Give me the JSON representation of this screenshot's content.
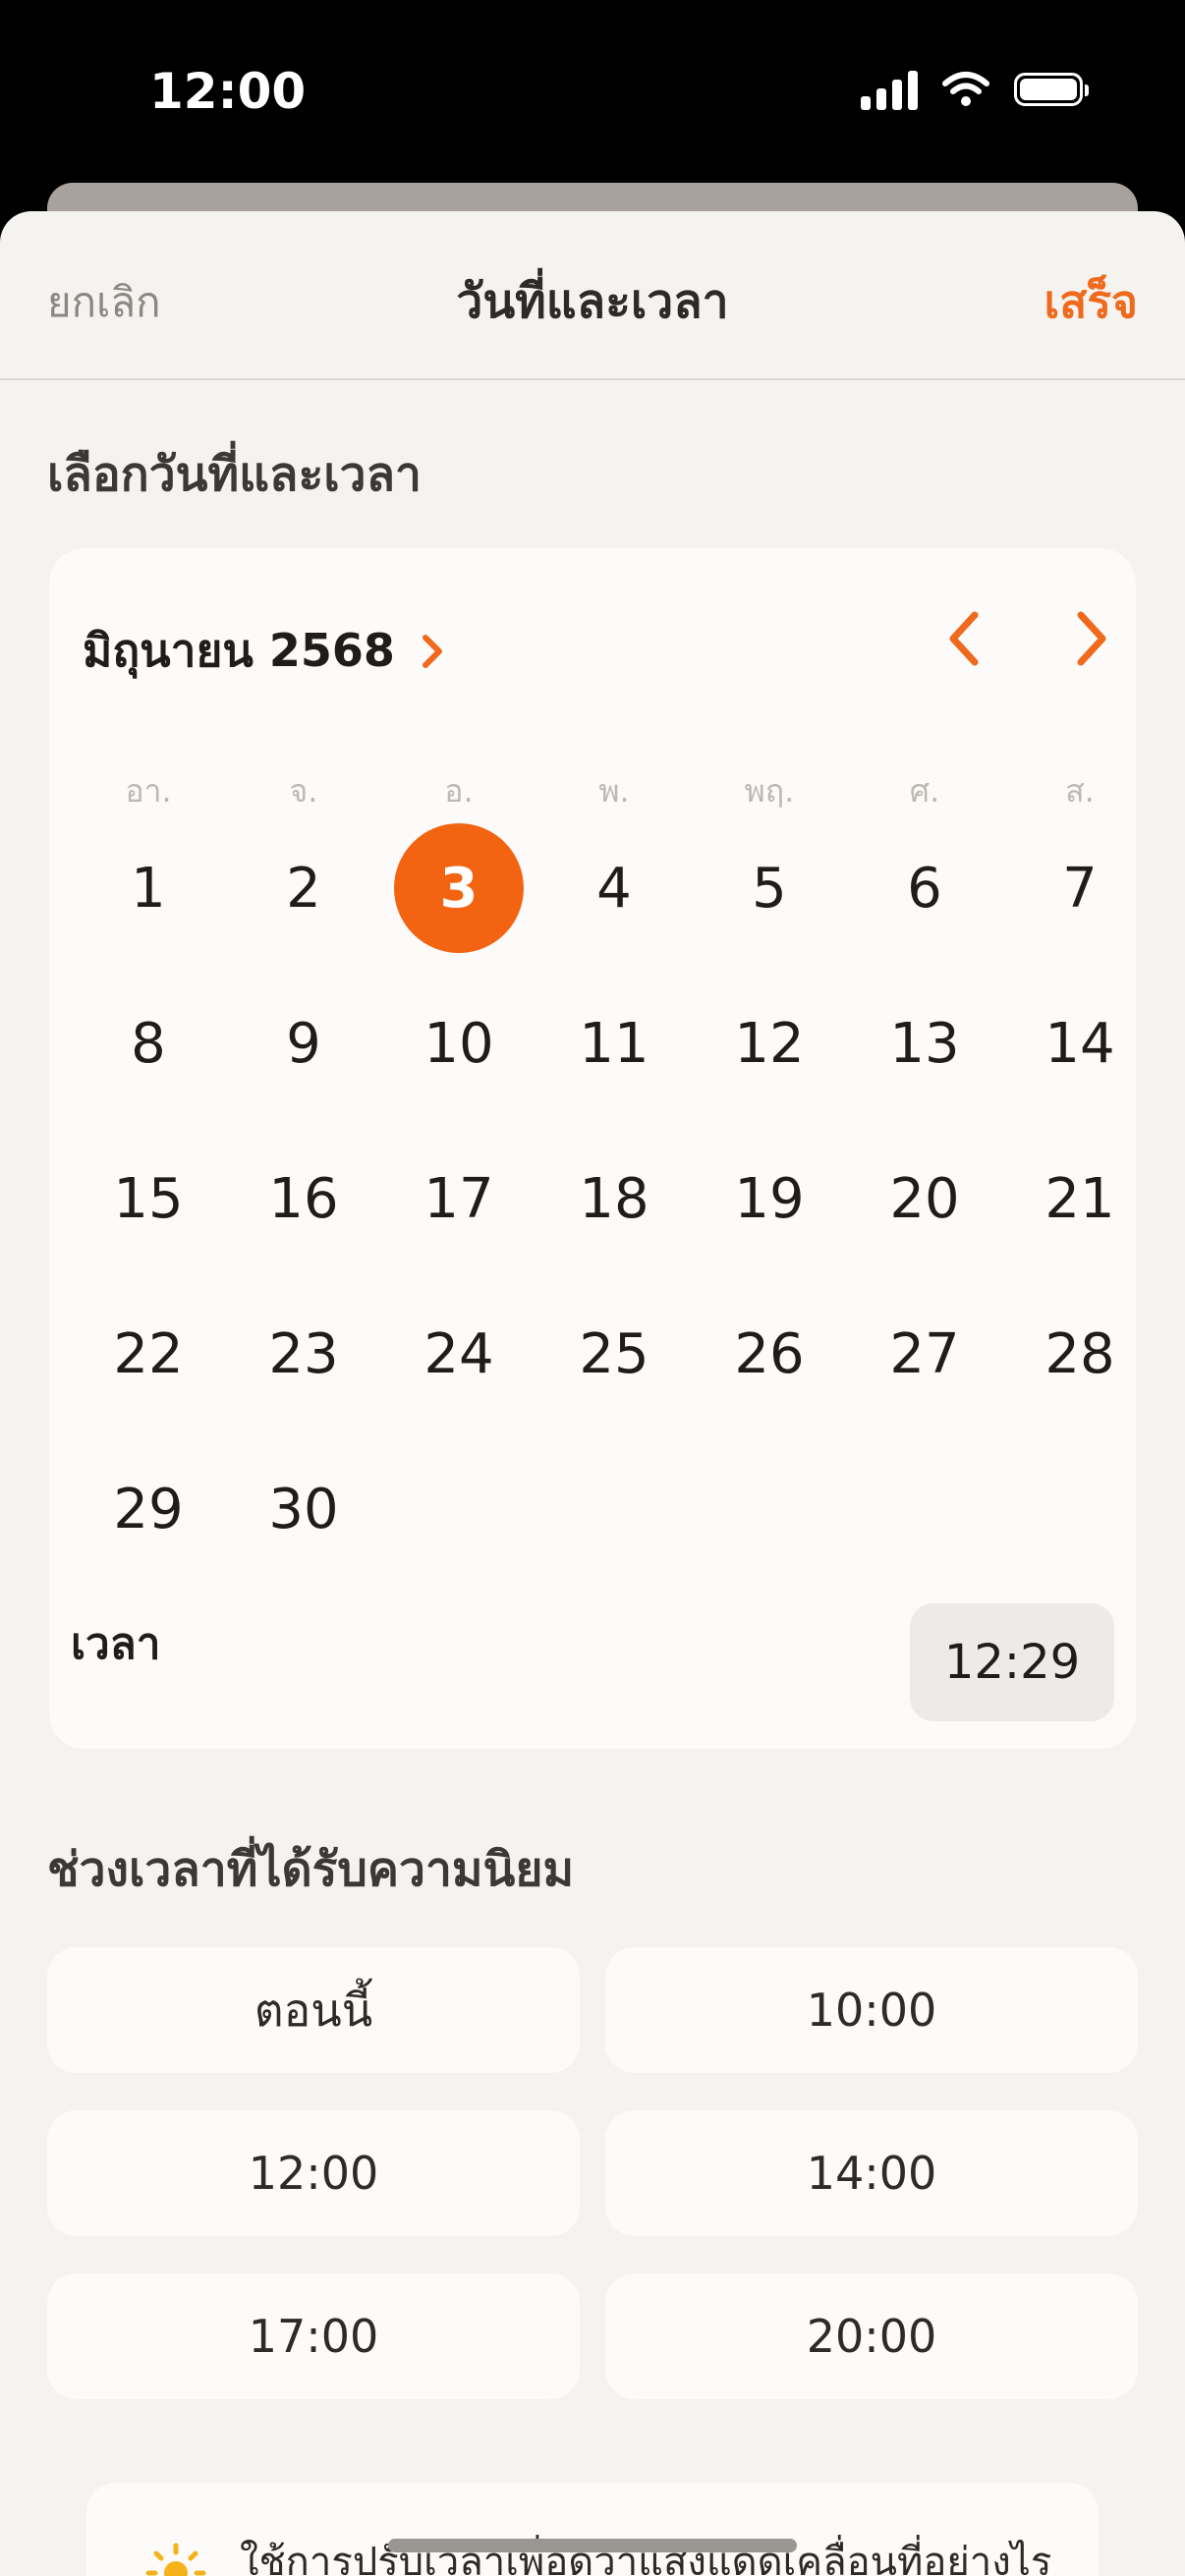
{
  "status": {
    "time": "12:00"
  },
  "nav": {
    "cancel": "ยกเลิก",
    "title": "วันที่และเวลา",
    "done": "เสร็จ"
  },
  "section_date": "เลือกวันที่และเวลา",
  "calendar": {
    "month_label": "มิถุนายน 2568",
    "weekdays": [
      "อา.",
      "จ.",
      "อ.",
      "พ.",
      "พฤ.",
      "ศ.",
      "ส."
    ],
    "days": [
      "1",
      "2",
      "3",
      "4",
      "5",
      "6",
      "7",
      "8",
      "9",
      "10",
      "11",
      "12",
      "13",
      "14",
      "15",
      "16",
      "17",
      "18",
      "19",
      "20",
      "21",
      "22",
      "23",
      "24",
      "25",
      "26",
      "27",
      "28",
      "29",
      "30"
    ],
    "selected_day": "3",
    "time_label": "เวลา",
    "time_value": "12:29"
  },
  "section_popular": "ช่วงเวลาที่ได้รับความนิยม",
  "slots": [
    "ตอนนี้",
    "10:00",
    "12:00",
    "14:00",
    "17:00",
    "20:00"
  ],
  "tip": {
    "text": "ใช้การปรับเวลาเพื่อดูว่าแสงแดดเคลื่อนที่อย่างไร"
  },
  "colors": {
    "accent": "#F26411",
    "background": "#F5F3F0",
    "card": "#FCFBFA"
  }
}
